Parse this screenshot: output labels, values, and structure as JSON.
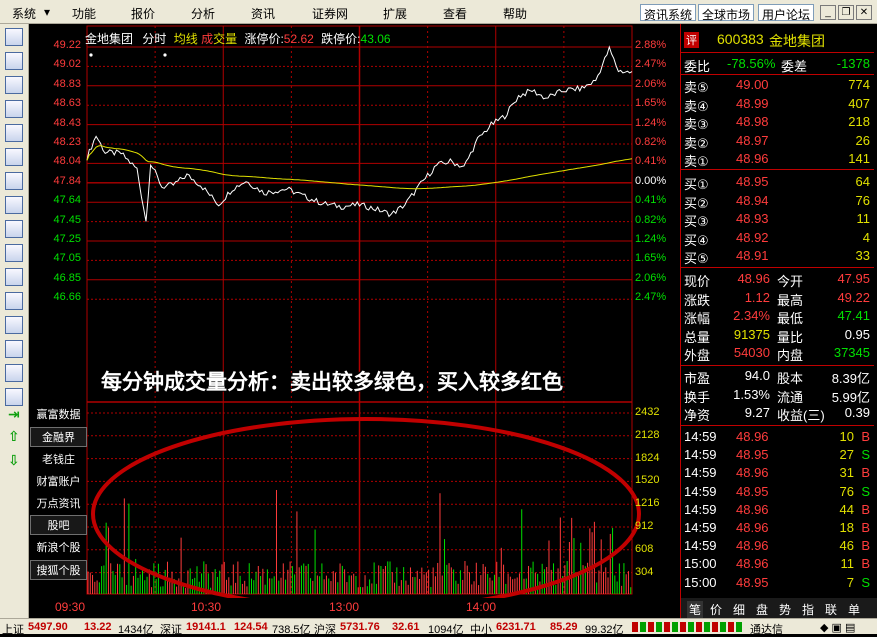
{
  "menu": {
    "items": [
      "系统",
      "功能",
      "报价",
      "分析",
      "资讯",
      "证券网",
      "扩展",
      "查看",
      "帮助"
    ],
    "buttons": [
      "资讯系统",
      "全球市场",
      "用户论坛"
    ]
  },
  "chart": {
    "stock_name": "金地集团",
    "mode_label": "分时",
    "avg_label": "均线",
    "vol_label_red": "成",
    "vol_label_yellow": "交量",
    "limit_up_label": "涨停价:",
    "limit_up": "52.62",
    "limit_down_label": "跌停价:",
    "limit_down": "43.06",
    "price_ticks": [
      "49.22",
      "49.02",
      "48.83",
      "48.63",
      "48.43",
      "48.23",
      "48.04",
      "47.84",
      "47.64",
      "47.45",
      "47.25",
      "47.05",
      "46.85",
      "46.66"
    ],
    "pct_ticks": [
      "2.88%",
      "2.47%",
      "2.06%",
      "1.65%",
      "1.24%",
      "0.82%",
      "0.41%",
      "0.00%",
      "0.41%",
      "0.82%",
      "1.24%",
      "1.65%",
      "2.06%",
      "2.47%"
    ],
    "vol_ticks": [
      "2432",
      "2128",
      "1824",
      "1520",
      "1216",
      "912",
      "608",
      "304"
    ],
    "time_labels": [
      "09:30",
      "10:30",
      "13:00",
      "14:00"
    ],
    "banner": "每分钟成交量分析：卖出较多绿色，买入较多红色",
    "left_links": [
      "赢富数据",
      "金融界",
      "老钱庄",
      "财富账户",
      "万点资讯",
      "股吧",
      "新浪个股",
      "搜狐个股"
    ]
  },
  "quote": {
    "code": "600383",
    "name": "金地集团",
    "badge": "评",
    "weibi_label": "委比",
    "weibi": "-78.56%",
    "weicha_label": "委差",
    "weicha": "-1378",
    "asks": [
      {
        "label": "卖⑤",
        "price": "49.00",
        "vol": "774"
      },
      {
        "label": "卖④",
        "price": "48.99",
        "vol": "407"
      },
      {
        "label": "卖③",
        "price": "48.98",
        "vol": "218"
      },
      {
        "label": "卖②",
        "price": "48.97",
        "vol": "26"
      },
      {
        "label": "卖①",
        "price": "48.96",
        "vol": "141"
      }
    ],
    "bids": [
      {
        "label": "买①",
        "price": "48.95",
        "vol": "64"
      },
      {
        "label": "买②",
        "price": "48.94",
        "vol": "76"
      },
      {
        "label": "买③",
        "price": "48.93",
        "vol": "11"
      },
      {
        "label": "买④",
        "price": "48.92",
        "vol": "4"
      },
      {
        "label": "买⑤",
        "price": "48.91",
        "vol": "33"
      }
    ],
    "stats": [
      {
        "l1": "现价",
        "v1": "48.96",
        "l2": "今开",
        "v2": "47.95"
      },
      {
        "l1": "涨跌",
        "v1": "1.12",
        "l2": "最高",
        "v2": "49.22"
      },
      {
        "l1": "涨幅",
        "v1": "2.34%",
        "l2": "最低",
        "v2": "47.41"
      },
      {
        "l1": "总量",
        "v1": "91375",
        "l2": "量比",
        "v2": "0.95"
      },
      {
        "l1": "外盘",
        "v1": "54030",
        "l2": "内盘",
        "v2": "37345"
      }
    ],
    "fund": [
      {
        "l1": "市盈",
        "v1": "94.0",
        "l2": "股本",
        "v2": "8.39亿"
      },
      {
        "l1": "换手",
        "v1": "1.53%",
        "l2": "流通",
        "v2": "5.99亿"
      },
      {
        "l1": "净资",
        "v1": "9.27",
        "l2": "收益(三)",
        "v2": "0.39"
      }
    ],
    "ticks": [
      {
        "t": "14:59",
        "p": "48.96",
        "v": "10",
        "s": "B"
      },
      {
        "t": "14:59",
        "p": "48.95",
        "v": "27",
        "s": "S"
      },
      {
        "t": "14:59",
        "p": "48.96",
        "v": "31",
        "s": "B"
      },
      {
        "t": "14:59",
        "p": "48.95",
        "v": "76",
        "s": "S"
      },
      {
        "t": "14:59",
        "p": "48.96",
        "v": "44",
        "s": "B"
      },
      {
        "t": "14:59",
        "p": "48.96",
        "v": "18",
        "s": "B"
      },
      {
        "t": "14:59",
        "p": "48.96",
        "v": "46",
        "s": "B"
      },
      {
        "t": "15:00",
        "p": "48.96",
        "v": "11",
        "s": "B"
      },
      {
        "t": "15:00",
        "p": "48.95",
        "v": "7",
        "s": "S"
      }
    ],
    "tabs": [
      "笔",
      "价",
      "细",
      "盘",
      "势",
      "指",
      "联",
      "单"
    ]
  },
  "status": {
    "sh_label": "上证",
    "sh_val": "5497.90",
    "sh_chg": "13.22",
    "sh_amt": "1434亿",
    "sz_label": "深证",
    "sz_val": "19141.1",
    "sz_chg": "124.54",
    "sz_amt": "738.5亿",
    "hs_label": "沪深",
    "hs_val": "5731.76",
    "hs_chg": "32.61",
    "hs_amt": "1094亿",
    "zx_label": "中小",
    "zx_val": "6231.71",
    "zx_chg": "85.29",
    "zx_amt": "99.32亿",
    "conn": "通达信"
  },
  "colors": {
    "up": "#ff3c3c",
    "down": "#00e000",
    "price_line": "#ffffff",
    "avg_line": "#e0e000",
    "grid": "#b00000"
  }
}
